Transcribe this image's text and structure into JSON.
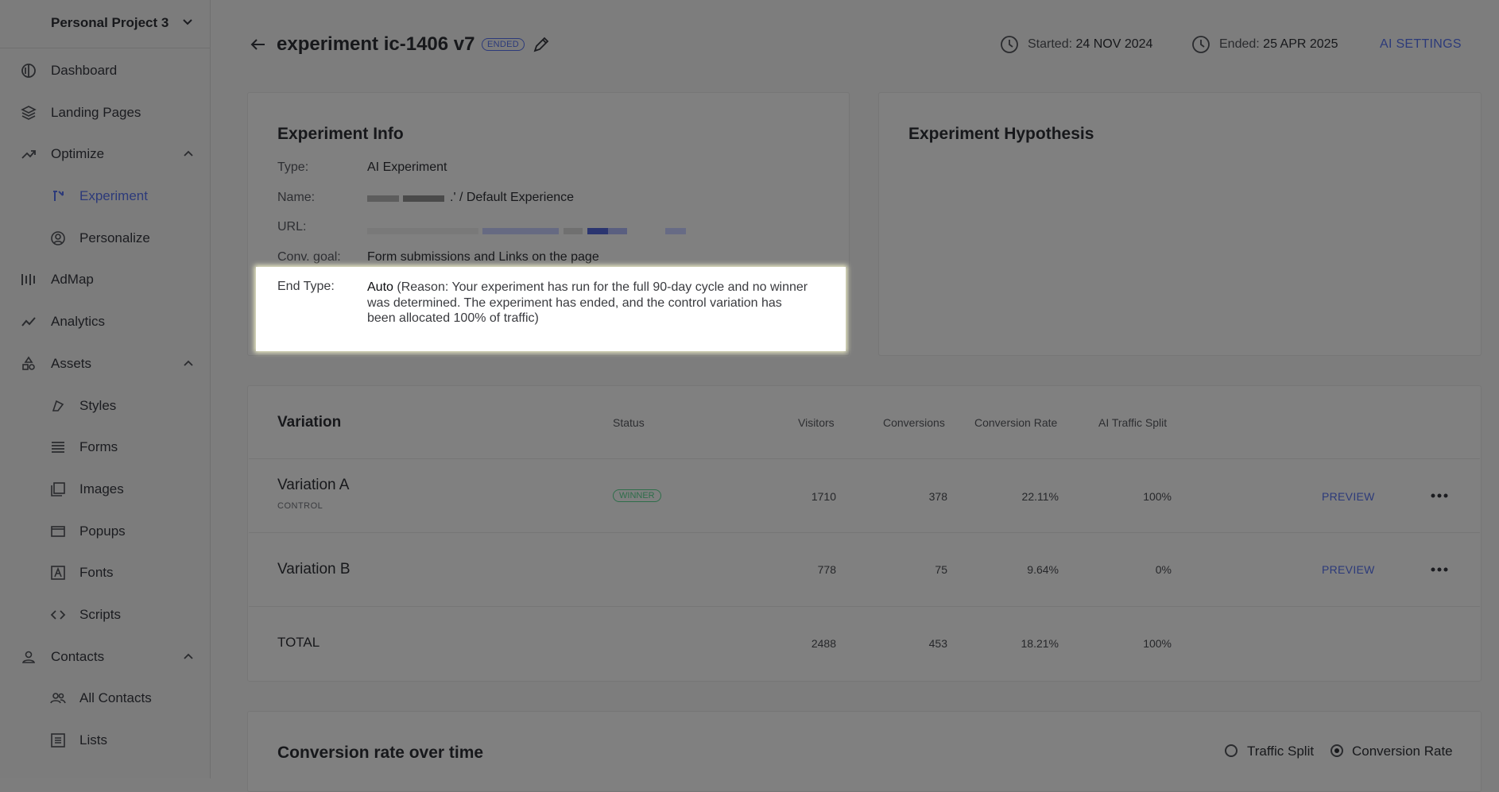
{
  "sidebar": {
    "project_name": "Personal Project 3",
    "items": [
      {
        "label": "Dashboard",
        "icon": "dashboard-icon"
      },
      {
        "label": "Landing Pages",
        "icon": "layers-icon"
      },
      {
        "label": "Optimize",
        "icon": "trend-icon"
      },
      {
        "label": "Experiment",
        "icon": "experiment-icon"
      },
      {
        "label": "Personalize",
        "icon": "user-circle-icon"
      },
      {
        "label": "AdMap",
        "icon": "admap-icon"
      },
      {
        "label": "Analytics",
        "icon": "analytics-icon"
      },
      {
        "label": "Assets",
        "icon": "assets-icon"
      },
      {
        "label": "Styles",
        "icon": "styles-icon"
      },
      {
        "label": "Forms",
        "icon": "forms-icon"
      },
      {
        "label": "Images",
        "icon": "images-icon"
      },
      {
        "label": "Popups",
        "icon": "popup-icon"
      },
      {
        "label": "Fonts",
        "icon": "fonts-icon"
      },
      {
        "label": "Scripts",
        "icon": "code-icon"
      },
      {
        "label": "Contacts",
        "icon": "contact-icon"
      },
      {
        "label": "All Contacts",
        "icon": "users-icon"
      },
      {
        "label": "Lists",
        "icon": "list-icon"
      }
    ]
  },
  "header": {
    "title": "experiment ic-1406 v7",
    "status_badge": "ENDED",
    "started_label": "Started:",
    "started_value": "24 NOV 2024",
    "ended_label": "Ended:",
    "ended_value": "25 APR 2025",
    "ai_settings": "AI SETTINGS"
  },
  "info": {
    "title": "Experiment Info",
    "type_key": "Type:",
    "type_value": "AI Experiment",
    "name_key": "Name:",
    "name_value": ".' / Default Experience",
    "url_key": "URL:",
    "goal_key": "Conv. goal:",
    "goal_value": "Form submissions and Links on the page",
    "end_type_key": "End Type:",
    "end_type_value": "Auto",
    "end_type_reason": "(Reason: Your experiment has run for the full 90-day cycle and no winner was determined. The experiment has ended, and the control variation has been allocated 100% of traffic)"
  },
  "hypothesis": {
    "title": "Experiment Hypothesis"
  },
  "table": {
    "headers": {
      "variation": "Variation",
      "status": "Status",
      "visitors": "Visitors",
      "conversions": "Conversions",
      "conversion_rate": "Conversion Rate",
      "traffic_split": "AI Traffic Split"
    },
    "rows": [
      {
        "name": "Variation A",
        "sub": "CONTROL",
        "status": "WINNER",
        "visitors": "1710",
        "conversions": "378",
        "rate": "22.11%",
        "split": "100%",
        "preview": "PREVIEW"
      },
      {
        "name": "Variation B",
        "sub": "",
        "status": "",
        "visitors": "778",
        "conversions": "75",
        "rate": "9.64%",
        "split": "0%",
        "preview": "PREVIEW"
      }
    ],
    "total": {
      "name": "TOTAL",
      "visitors": "2488",
      "conversions": "453",
      "rate": "18.21%",
      "split": "100%"
    }
  },
  "chart_section": {
    "title": "Conversion rate over time",
    "option_traffic": "Traffic Split",
    "option_rate": "Conversion Rate",
    "selected": "Conversion Rate"
  }
}
